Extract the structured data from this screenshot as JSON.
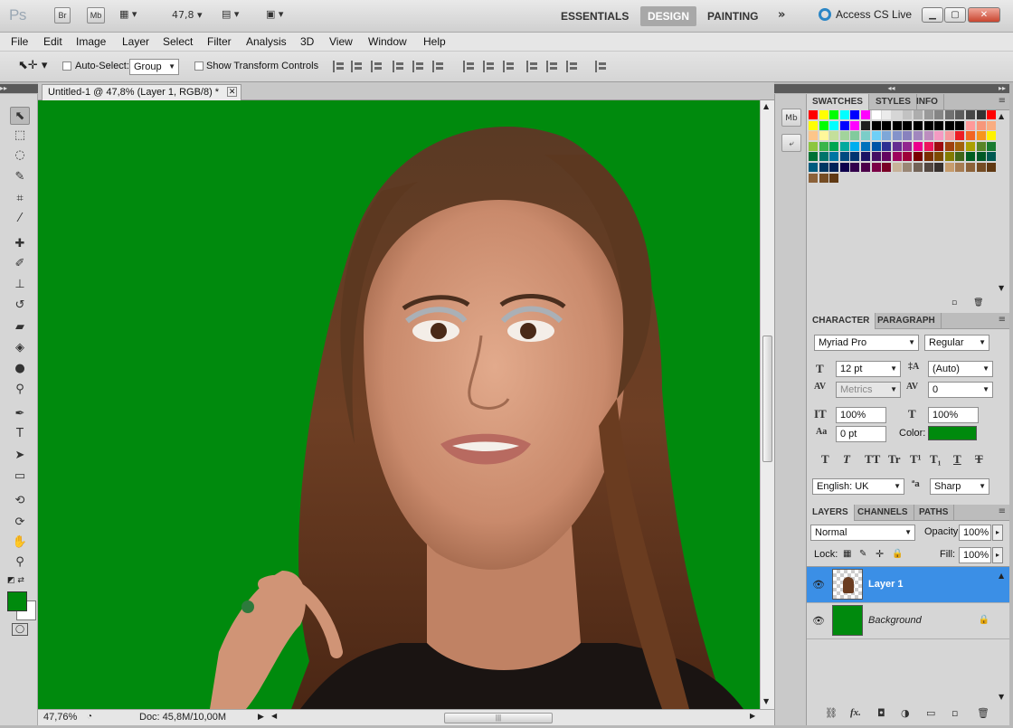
{
  "colors": {
    "canvas": "#008a0d",
    "selection": "#3b8fe6",
    "foreground": "#008a0d"
  },
  "appbar": {
    "logo": "Ps",
    "bridge": "Br",
    "minibridge": "Mb",
    "zoom": "47,8",
    "workspaces": [
      "ESSENTIALS",
      "DESIGN",
      "PAINTING"
    ],
    "active_workspace": "DESIGN",
    "cs_live": "Access CS Live"
  },
  "menu": [
    "File",
    "Edit",
    "Image",
    "Layer",
    "Select",
    "Filter",
    "Analysis",
    "3D",
    "View",
    "Window",
    "Help"
  ],
  "options": {
    "auto_select_label": "Auto-Select:",
    "auto_select_value": "Group",
    "transform_label": "Show Transform Controls"
  },
  "document": {
    "tab_title": "Untitled-1 @ 47,8% (Layer 1, RGB/8) *",
    "zoom_status": "47,76%",
    "doc_size": "Doc: 45,8M/10,00M"
  },
  "strip": {
    "minibridge": "Mb"
  },
  "swatches_panel": {
    "tabs": [
      "SWATCHES",
      "STYLES",
      "INFO"
    ],
    "rows": [
      [
        "#ff0000",
        "#ffff00",
        "#00ff00",
        "#00ffff",
        "#0000ff",
        "#ff00ff",
        "#ffffff",
        "#ebebeb",
        "#d6d6d6",
        "#c2c2c2",
        "#adadad",
        "#999999",
        "#858585",
        "#707070",
        "#5c5c5c",
        "#474747",
        "#333333",
        "#ff0000"
      ],
      [
        "#ffff00",
        "#00ff00",
        "#00ffff",
        "#0000ff",
        "#ff00ff",
        "#1f1f1f",
        "#000000",
        "#000000",
        "#000000",
        "#000000",
        "#000000",
        "#000000",
        "#000000",
        "#000000",
        "#000000",
        "#ff9999",
        "#f7977a",
        "#f9ad81"
      ],
      [
        "#fdc68a",
        "#fff79a",
        "#c4df9b",
        "#a2d39c",
        "#82ca9d",
        "#7bcdc8",
        "#6ecff6",
        "#7ea7d8",
        "#8493ca",
        "#8882be",
        "#a187be",
        "#bc8dbf",
        "#f49ac2",
        "#f6989d",
        "#ed1c24",
        "#f26522",
        "#f7941d",
        "#fff200"
      ],
      [
        "#8dc63f",
        "#39b54a",
        "#00a651",
        "#00a99d",
        "#00aeef",
        "#0072bc",
        "#0054a6",
        "#2e3192",
        "#662d91",
        "#92278f",
        "#ec008c",
        "#ed145b",
        "#9e0b0f",
        "#a0410d",
        "#a3620a",
        "#aba000",
        "#598527",
        "#197b30"
      ],
      [
        "#007236",
        "#00746b",
        "#0076a3",
        "#004a80",
        "#003471",
        "#1b1464",
        "#440e62",
        "#630460",
        "#9e005d",
        "#9e0039",
        "#790000",
        "#7b2e00",
        "#7d4900",
        "#827b00",
        "#406618",
        "#005e20",
        "#005826",
        "#005952"
      ],
      [
        "#005b7f",
        "#003663",
        "#002157",
        "#0d004c",
        "#32004b",
        "#4b0049",
        "#7b0046",
        "#7a0026",
        "#c7b299",
        "#998675",
        "#736357",
        "#534741",
        "#37302d",
        "#c69c6d",
        "#a67c52",
        "#8c6239",
        "#754c24",
        "#603913"
      ],
      [
        "#8c6239",
        "#754c24",
        "#603913"
      ]
    ]
  },
  "character_panel": {
    "tabs": [
      "CHARACTER",
      "PARAGRAPH"
    ],
    "font_family": "Myriad Pro",
    "font_style": "Regular",
    "font_size": "12 pt",
    "leading": "(Auto)",
    "kerning": "Metrics",
    "tracking": "0",
    "vertical_scale": "100%",
    "horizontal_scale": "100%",
    "baseline_shift": "0 pt",
    "color_label": "Color:",
    "language": "English: UK",
    "antialias": "Sharp",
    "style_buttons": [
      "T",
      "T",
      "TT",
      "Tr",
      "T¹",
      "T₁",
      "T",
      "T"
    ]
  },
  "layers_panel": {
    "tabs": [
      "LAYERS",
      "CHANNELS",
      "PATHS"
    ],
    "blend_mode": "Normal",
    "opacity_label": "Opacity:",
    "opacity": "100%",
    "lock_label": "Lock:",
    "fill_label": "Fill:",
    "fill": "100%",
    "layers": [
      {
        "name": "Layer 1",
        "selected": true
      },
      {
        "name": "Background",
        "selected": false
      }
    ],
    "footer_icons": [
      "link-icon",
      "fx-icon",
      "mask-icon",
      "adjustment-icon",
      "group-icon",
      "new-layer-icon",
      "trash-icon"
    ]
  }
}
